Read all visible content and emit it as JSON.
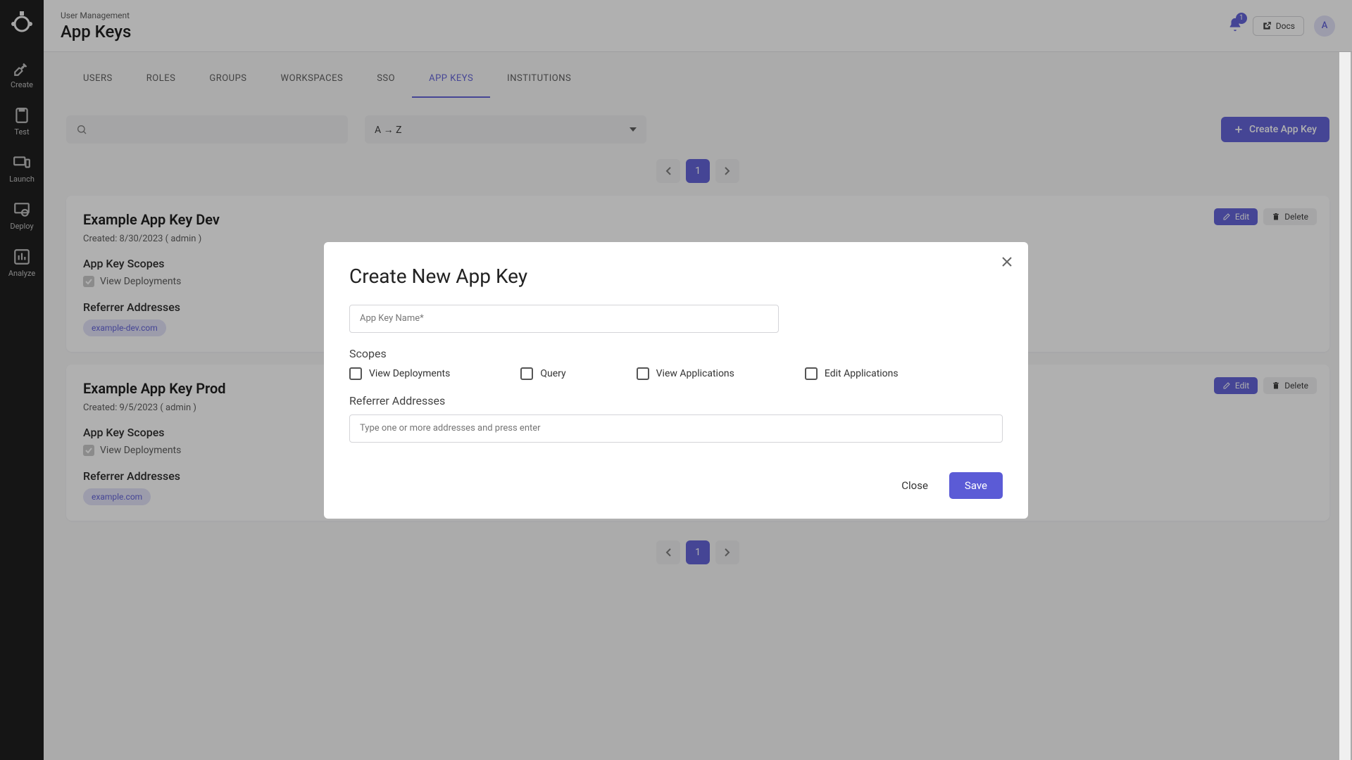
{
  "breadcrumb": "User Management",
  "page_title": "App Keys",
  "sidebar": {
    "items": [
      {
        "label": "Create"
      },
      {
        "label": "Test"
      },
      {
        "label": "Launch"
      },
      {
        "label": "Deploy"
      },
      {
        "label": "Analyze"
      }
    ]
  },
  "header": {
    "notification_count": "1",
    "docs_label": "Docs",
    "avatar_initial": "A"
  },
  "tabs": [
    {
      "label": "USERS"
    },
    {
      "label": "ROLES"
    },
    {
      "label": "GROUPS"
    },
    {
      "label": "WORKSPACES"
    },
    {
      "label": "SSO"
    },
    {
      "label": "APP KEYS",
      "active": true
    },
    {
      "label": "INSTITUTIONS"
    }
  ],
  "sort_selected": "A → Z",
  "create_button": "Create App Key",
  "pagination": {
    "current": "1"
  },
  "cards": [
    {
      "title": "Example App Key Dev",
      "meta": "Created: 8/30/2023 ( admin )",
      "scopes_title": "App Key Scopes",
      "scope_label": "View Deployments",
      "referrer_title": "Referrer Addresses",
      "referrer": "example-dev.com",
      "edit": "Edit",
      "delete": "Delete"
    },
    {
      "title": "Example App Key Prod",
      "meta": "Created: 9/5/2023 ( admin )",
      "scopes_title": "App Key Scopes",
      "scope_label": "View Deployments",
      "referrer_title": "Referrer Addresses",
      "referrer": "example.com",
      "edit": "Edit",
      "delete": "Delete"
    }
  ],
  "modal": {
    "title": "Create New App Key",
    "name_placeholder": "App Key Name*",
    "scopes_title": "Scopes",
    "scopes": [
      "View Deployments",
      "Query",
      "View Applications",
      "Edit Applications"
    ],
    "referrer_title": "Referrer Addresses",
    "referrer_placeholder": "Type one or more addresses and press enter",
    "close": "Close",
    "save": "Save"
  }
}
